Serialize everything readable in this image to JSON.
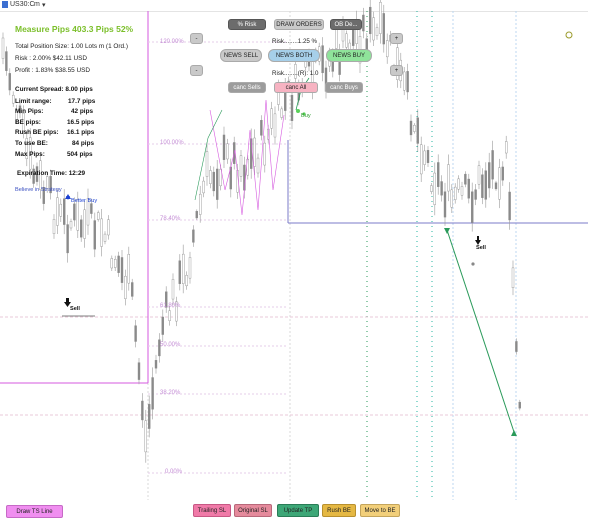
{
  "tab": {
    "symbol": "US30:C",
    "timeframe": "m"
  },
  "info": {
    "title": "Measure Pips 403.3 Pips   52%",
    "position_size": "Total Position Size: 1.00 Lots m (1 Ord.)",
    "risk": "Risk   : 2.00% $42.11 USD",
    "profit": "Profit : 1.83% $38.55 USD",
    "current_spread": "Current Spread: 8.00 pips",
    "limit_range": [
      "Limit range:",
      "17.7 pips"
    ],
    "min_pips": [
      "Min Pips:",
      "42 pips"
    ],
    "be_pips": [
      "BE pips:",
      "16.5 pips"
    ],
    "rush_be_pips": [
      "Rush BE pips:",
      "16.1 pips"
    ],
    "to_use_be": [
      "To use BE:",
      "84 pips"
    ],
    "max_pips": [
      "Max Pips:",
      "504 pips"
    ],
    "expiration": "Expiration Time: 12:29"
  },
  "panel": {
    "pct_risk": "% Risk",
    "draw_orders": "DRAW ORDERS",
    "ob_de": "OB De...",
    "minus_1": "-",
    "minus_2": "-",
    "plus_1": "+",
    "plus_2": "+",
    "risk_line": "Risk........1.25 %",
    "news_sell": "NEWS SELL",
    "news_both": "NEWS BOTH",
    "news_buy": "NEWS BUY",
    "risk_r_line": "Risk........(R): 1.0",
    "canc_sells": "canc Sells",
    "canc_all": "canc All",
    "canc_buys": "canc Buys"
  },
  "chart_labels": {
    "believe": "Believe in Strategy",
    "better_buy": "Better Buy",
    "sell_1": "Sell",
    "sell_2": "Sell",
    "sell_3": "Sell",
    "buy_green": "Buy"
  },
  "fib_levels": [
    "120.00%",
    "100.00%",
    "78.40%",
    "61.80%",
    "50.00%",
    "38.20%",
    "23.60%",
    "0.00%"
  ],
  "bottom_buttons": {
    "draw_ts_line": "Draw TS Line",
    "trailing_sl": "Trailing SL",
    "original_sl": "Original SL",
    "update_tp": "Update TP",
    "rush_be": "Rush BE",
    "move_to_be": "Move to BE"
  },
  "colors": {
    "fib": "#c58fd6",
    "candle": "#9a9a9a",
    "tp_line": "#2a9a5a",
    "sl_line": "#7b7bc9",
    "magenta": "#d65adf",
    "cyan_dash": "#26b5a0"
  }
}
